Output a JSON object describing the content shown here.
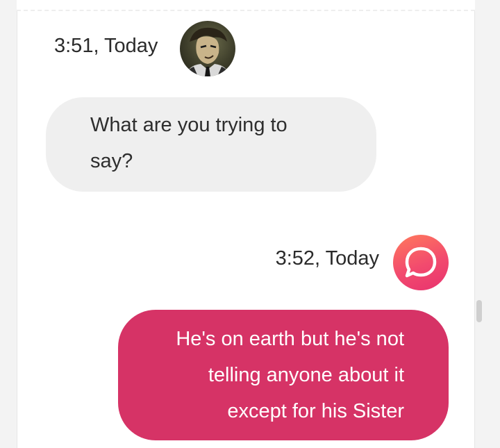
{
  "messages": [
    {
      "timestamp": "3:51, Today",
      "text": "What are you trying to say?",
      "sender_icon": "character-avatar"
    },
    {
      "timestamp": "3:52, Today",
      "text": "He's on earth but he's not telling anyone about it except for his Sister",
      "sender_icon": "chat-bubble-icon"
    }
  ],
  "colors": {
    "incoming_bubble": "#efefef",
    "outgoing_bubble": "#d63366",
    "app_icon_gradient_start": "#ff7a5c",
    "app_icon_gradient_end": "#e8336f"
  }
}
